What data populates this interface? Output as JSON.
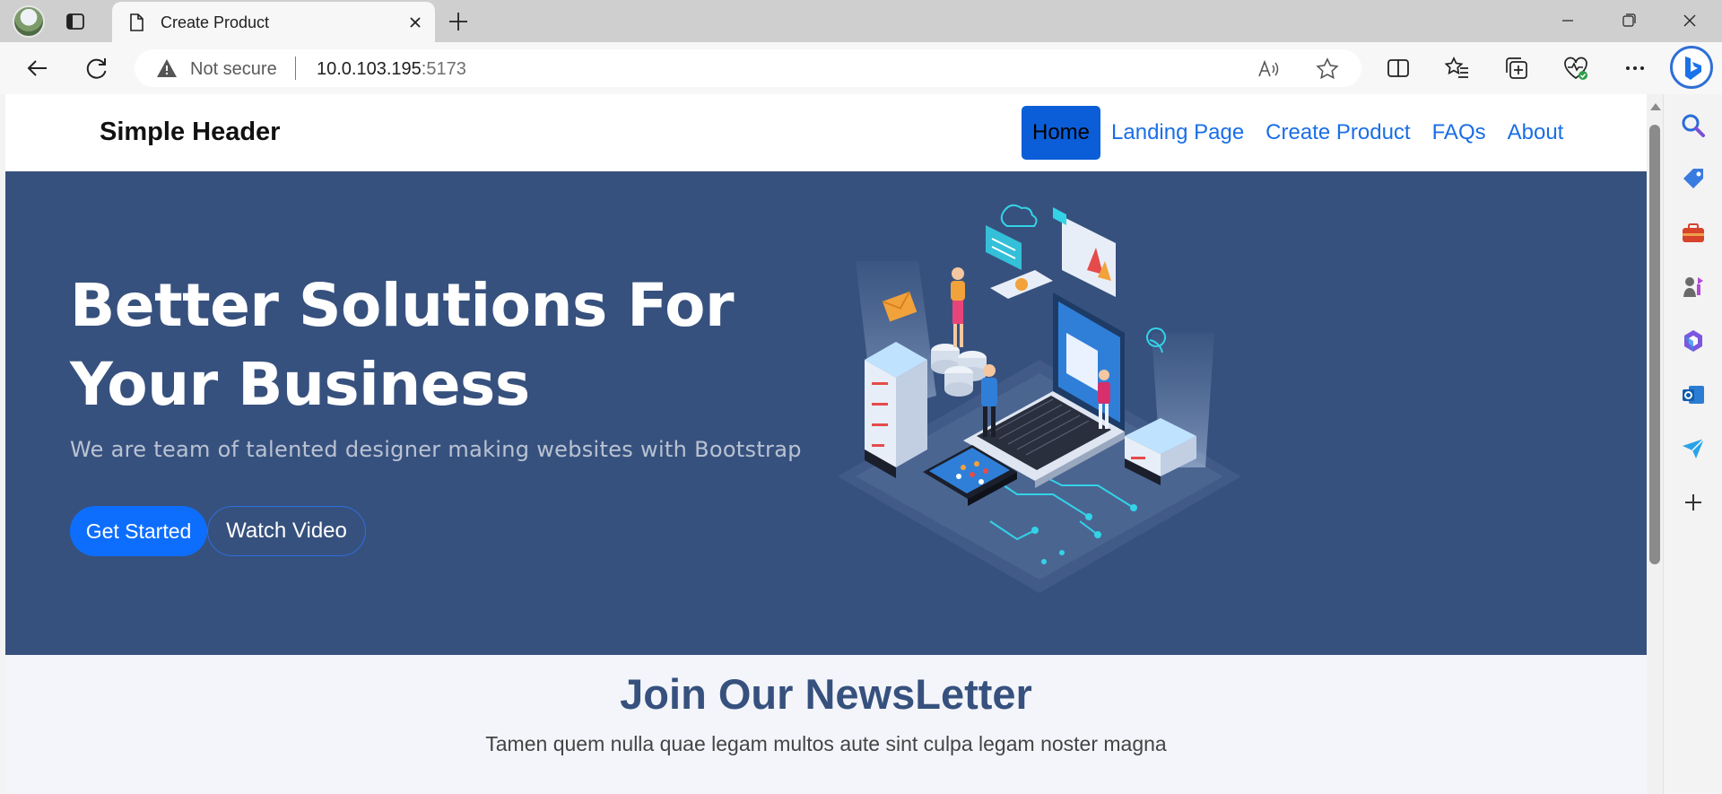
{
  "browser": {
    "tab_title": "Create Product",
    "address": {
      "security_label": "Not secure",
      "host": "10.0.103.195",
      "port": ":5173"
    }
  },
  "site": {
    "brand": "Simple Header",
    "nav": [
      {
        "label": "Home",
        "active": true
      },
      {
        "label": "Landing Page",
        "active": false
      },
      {
        "label": "Create Product",
        "active": false
      },
      {
        "label": "FAQs",
        "active": false
      },
      {
        "label": "About",
        "active": false
      }
    ]
  },
  "hero": {
    "title": "Better Solutions For Your Business",
    "subtitle": "We are team of talented designer making websites with Bootstrap",
    "primary_button": "Get Started",
    "secondary_button": "Watch Video"
  },
  "newsletter": {
    "title": "Join Our NewsLetter",
    "text": "Tamen quem nulla quae legam multos aute sint culpa legam noster magna"
  },
  "colors": {
    "hero_bg": "#37517e",
    "primary": "#0d6efd",
    "link": "#1a6ee6",
    "newsletter_bg": "#f3f5fa"
  },
  "icons": {
    "toolbar": [
      "back-icon",
      "refresh-icon",
      "read-aloud-icon",
      "favorite-star-icon",
      "split-screen-icon",
      "favorites-icon",
      "collections-icon",
      "browser-essentials-icon",
      "more-icon",
      "copilot-icon"
    ],
    "sidebar": [
      "search-icon",
      "shopping-tag-icon",
      "tools-icon",
      "games-icon",
      "office-icon",
      "outlook-icon",
      "send-icon",
      "add-icon"
    ]
  }
}
